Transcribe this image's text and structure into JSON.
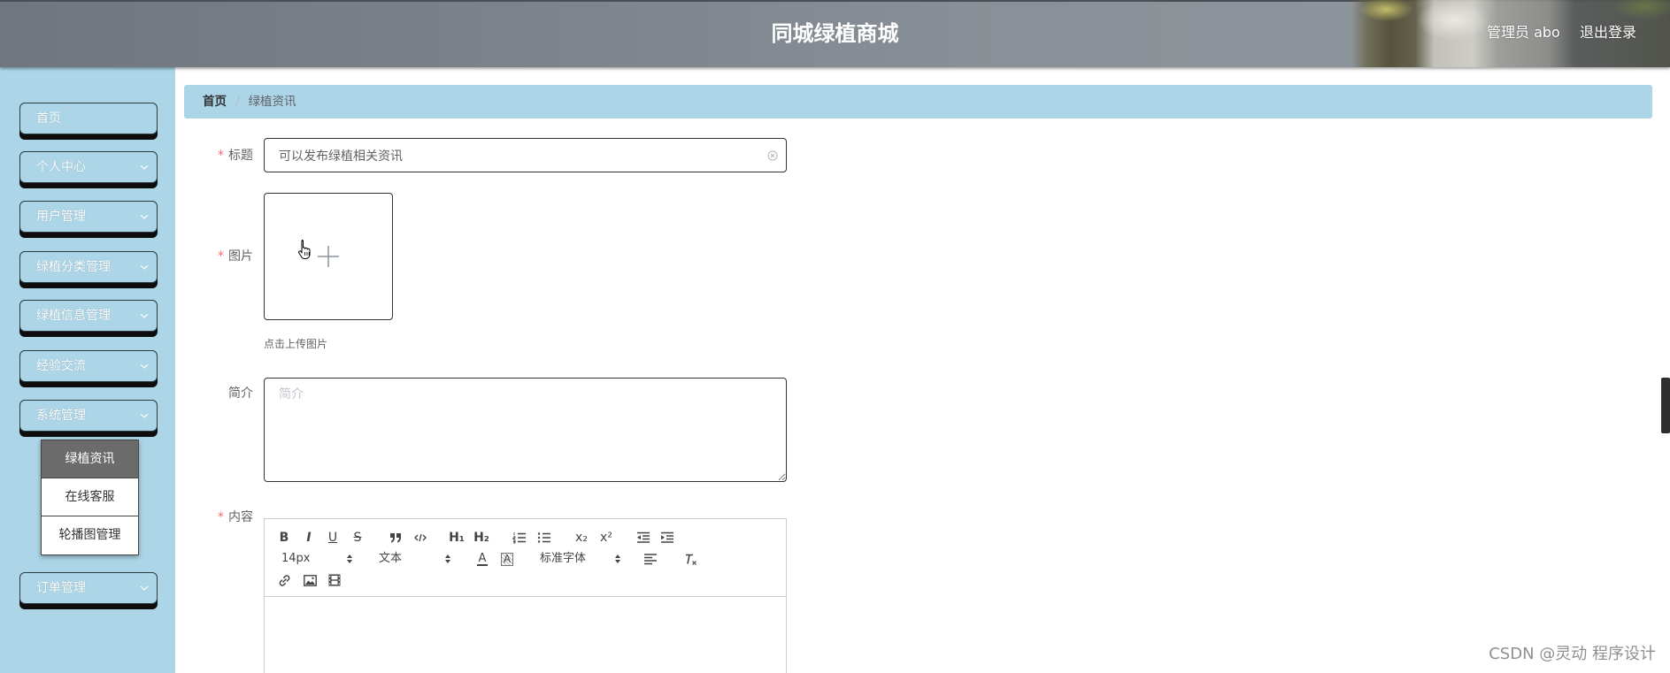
{
  "header": {
    "title": "同城绿植商城",
    "user_label": "管理员 abo",
    "logout_label": "退出登录"
  },
  "sidebar": {
    "items": [
      {
        "label": "首页"
      },
      {
        "label": "个人中心",
        "icon": "chevron-down-icon"
      },
      {
        "label": "用户管理",
        "icon": "chevron-down-icon"
      },
      {
        "label": "绿植分类管理",
        "icon": "chevron-down-icon"
      },
      {
        "label": "绿植信息管理",
        "icon": "chevron-down-icon"
      },
      {
        "label": "经验交流",
        "icon": "chevron-down-icon"
      },
      {
        "label": "系统管理",
        "icon": "chevron-down-icon",
        "expanded": true
      },
      {
        "label": "订单管理",
        "icon": "chevron-down-icon"
      }
    ],
    "submenu": [
      {
        "label": "绿植资讯",
        "active": true
      },
      {
        "label": "在线客服",
        "active": false
      },
      {
        "label": "轮播图管理",
        "active": false
      }
    ]
  },
  "breadcrumb": {
    "home": "首页",
    "separator": "/",
    "current": "绿植资讯"
  },
  "form": {
    "required_mark": "*",
    "title": {
      "label": "标题",
      "value": "可以发布绿植相关资讯",
      "clear_icon": "circle-close-icon"
    },
    "image": {
      "label": "图片",
      "upload_icon": "plus-icon",
      "hint": "点击上传图片"
    },
    "summary": {
      "label": "简介",
      "placeholder": "简介"
    },
    "content": {
      "label": "内容"
    }
  },
  "editor": {
    "toolbar": {
      "bold": {
        "icon": "bold-icon",
        "glyph": "B"
      },
      "italic": {
        "icon": "italic-icon",
        "glyph": "I"
      },
      "underline": {
        "icon": "underline-icon",
        "glyph": "U"
      },
      "strike": {
        "icon": "strikethrough-icon",
        "glyph": "S"
      },
      "blockquote": {
        "icon": "blockquote-icon"
      },
      "code": {
        "icon": "code-block-icon"
      },
      "h1": {
        "icon": "heading-1-icon",
        "glyph": "H₁"
      },
      "h2": {
        "icon": "heading-2-icon",
        "glyph": "H₂"
      },
      "ordered_list": {
        "icon": "ordered-list-icon"
      },
      "bullet_list": {
        "icon": "bullet-list-icon"
      },
      "subscript": {
        "icon": "subscript-icon",
        "glyph": "x₂"
      },
      "superscript": {
        "icon": "superscript-icon",
        "glyph": "x²"
      },
      "outdent": {
        "icon": "outdent-icon"
      },
      "indent": {
        "icon": "indent-icon"
      },
      "font_color": {
        "icon": "font-color-icon",
        "glyph": "A"
      },
      "background_color": {
        "icon": "background-color-icon",
        "glyph": "A"
      },
      "align": {
        "icon": "align-left-icon"
      },
      "clean": {
        "icon": "clear-format-icon"
      },
      "link": {
        "icon": "link-icon"
      },
      "image": {
        "icon": "image-icon"
      },
      "video": {
        "icon": "video-icon"
      }
    },
    "font_size": "14px",
    "header_select": "文本",
    "font_family": "标准字体"
  },
  "cursor": {
    "icon": "hand-pointer-icon"
  },
  "watermark": "CSDN @灵动 程序设计",
  "colors": {
    "sidebar_bg": "#acd6e8",
    "breadcrumb_bg": "#acd6e8",
    "submenu_active_bg": "#6b6b6b",
    "required_mark": "#f56c6c",
    "header_text": "#ffffff"
  }
}
